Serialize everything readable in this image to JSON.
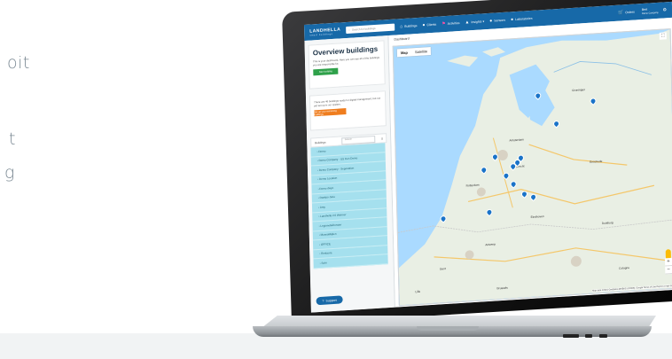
{
  "left_text": [
    "oit",
    "t",
    "g"
  ],
  "app": {
    "logo": "LANDHELLA",
    "logo_sub": "smart buildings",
    "search_placeholder": "Search for buildings",
    "nav": [
      {
        "icon": "building-icon",
        "glyph": "⌂",
        "label": "Buildings"
      },
      {
        "icon": "user-icon",
        "glyph": "●",
        "label": "Clients"
      },
      {
        "icon": "flag-icon",
        "glyph": "⚑",
        "label": "Activities"
      },
      {
        "icon": "chart-icon",
        "glyph": "▲",
        "label": "Insights ▾"
      },
      {
        "icon": "person-icon",
        "glyph": "●",
        "label": "Sensors"
      },
      {
        "icon": "person-icon",
        "glyph": "●",
        "label": "Laboratories"
      }
    ],
    "orders_label": "Orders",
    "user_name": "Bert",
    "user_company": "Demo Company",
    "breadcrumb": "Dashboard"
  },
  "sidebar": {
    "title": "Overview buildings",
    "intro": "This is your dashboard. Here you can see all of the buildings you are responsible for.",
    "new_button": "New building",
    "notice": "There are 46 buildings ready for digital management, but not yet set up in our system.",
    "notice_button": "Set up your remaining buildings",
    "buildings_label": "Buildings",
    "buildings_search": "Search",
    "buildings": [
      "Demo",
      "Demo Company - US Cen Demo",
      "Demo Company - Segovation",
      "Demo Location",
      "Demo dwyn",
      "Dwelpo Jane",
      "Amy",
      "Landhella 2.0 Wehner",
      "LegionellaDossier",
      "MuseaMijden",
      "OFFICE",
      "Restaura",
      "Sohr"
    ],
    "support_label": "Support"
  },
  "map": {
    "tab_map": "Map",
    "tab_satellite": "Satellite",
    "zoom_in": "+",
    "zoom_out": "−",
    "attribution": "Map data ©2021 GeoBasis-DE/BKG (©2009), Google   Terms of Use   Report a map error",
    "labels": [
      "Groningen",
      "Amsterdam",
      "Rotterdam",
      "Antwerp",
      "Brussels",
      "Gent",
      "Duisburg",
      "Cologne",
      "Eindhoven",
      "Utrecht",
      "Lille",
      "Enschede"
    ]
  },
  "colors": {
    "nav_bar": "#1769a8",
    "list_row": "#a5e0ee",
    "green_button": "#2fa14a",
    "orange_button": "#ef7d1e",
    "pin": "#1a73c8"
  }
}
